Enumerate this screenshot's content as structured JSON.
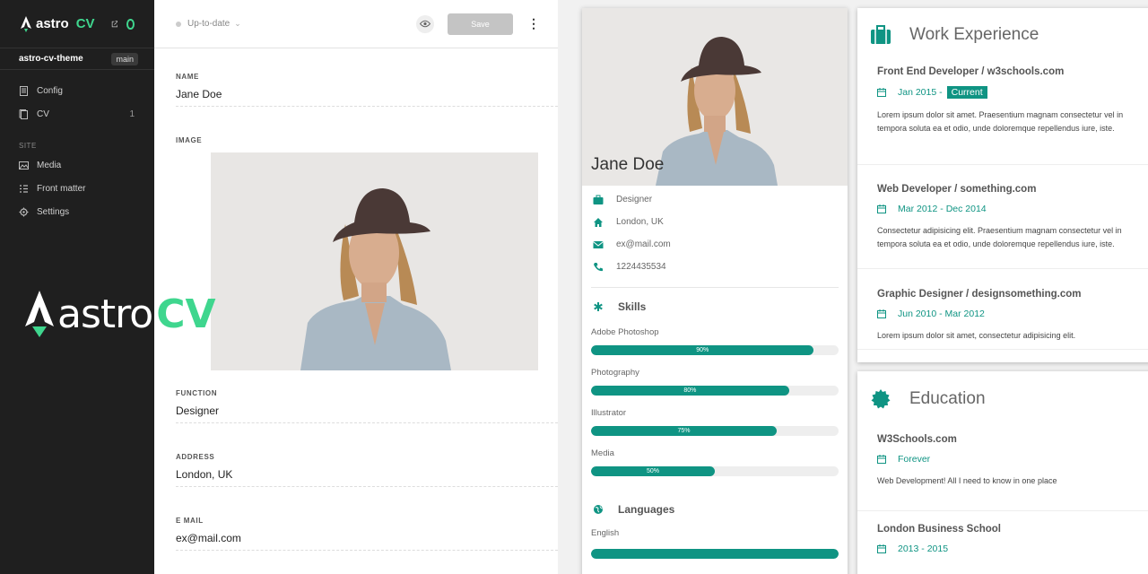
{
  "sidebar": {
    "logo_text": "astro",
    "logo_cv": "CV",
    "repo": "astro-cv-theme",
    "branch": "main",
    "items": [
      {
        "label": "Config",
        "count": ""
      },
      {
        "label": "CV",
        "count": "1"
      }
    ],
    "section_site": "SITE",
    "site_items": [
      {
        "label": "Media"
      },
      {
        "label": "Front matter"
      },
      {
        "label": "Settings"
      }
    ]
  },
  "overlay_logo": {
    "text": "astro",
    "cv": "CV"
  },
  "editor": {
    "status": "Up-to-date",
    "save_label": "Save",
    "fields": {
      "name": {
        "label": "NAME",
        "value": "Jane Doe"
      },
      "image": {
        "label": "IMAGE"
      },
      "function": {
        "label": "FUNCTION",
        "value": "Designer"
      },
      "address": {
        "label": "ADDRESS",
        "value": "London, UK"
      },
      "email": {
        "label": "E MAIL",
        "value": "ex@mail.com"
      }
    }
  },
  "preview": {
    "name": "Jane Doe",
    "info": [
      "Designer",
      "London, UK",
      "ex@mail.com",
      "1224435534"
    ],
    "skills_title": "Skills",
    "skills": [
      {
        "name": "Adobe Photoshop",
        "value": 90,
        "label": "90%"
      },
      {
        "name": "Photography",
        "value": 80,
        "label": "80%"
      },
      {
        "name": "Illustrator",
        "value": 75,
        "label": "75%"
      },
      {
        "name": "Media",
        "value": 50,
        "label": "50%"
      }
    ],
    "languages_title": "Languages",
    "languages": [
      {
        "name": "English",
        "value": 100
      }
    ],
    "work_title": "Work Experience",
    "jobs": [
      {
        "title": "Front End Developer / w3schools.com",
        "date": "Jan 2015 -",
        "current": "Current",
        "desc1": "Lorem ipsum dolor sit amet. Praesentium magnam consectetur vel in",
        "desc2": "tempora soluta ea et odio, unde doloremque repellendus iure, iste."
      },
      {
        "title": "Web Developer / something.com",
        "date": "Mar 2012 - Dec 2014",
        "current": "",
        "desc1": "Consectetur adipisicing elit. Praesentium magnam consectetur vel in",
        "desc2": "tempora soluta ea et odio, unde doloremque repellendus iure, iste."
      },
      {
        "title": "Graphic Designer / designsomething.com",
        "date": "Jun 2010 - Mar 2012",
        "current": "",
        "desc1": "Lorem ipsum dolor sit amet, consectetur adipisicing elit.",
        "desc2": ""
      }
    ],
    "education_title": "Education",
    "education": [
      {
        "title": "W3Schools.com",
        "date": "Forever",
        "desc1": "Web Development! All I need to know in one place"
      },
      {
        "title": "London Business School",
        "date": "2013 - 2015",
        "desc1": ""
      }
    ],
    "accent": "#0f9483"
  }
}
